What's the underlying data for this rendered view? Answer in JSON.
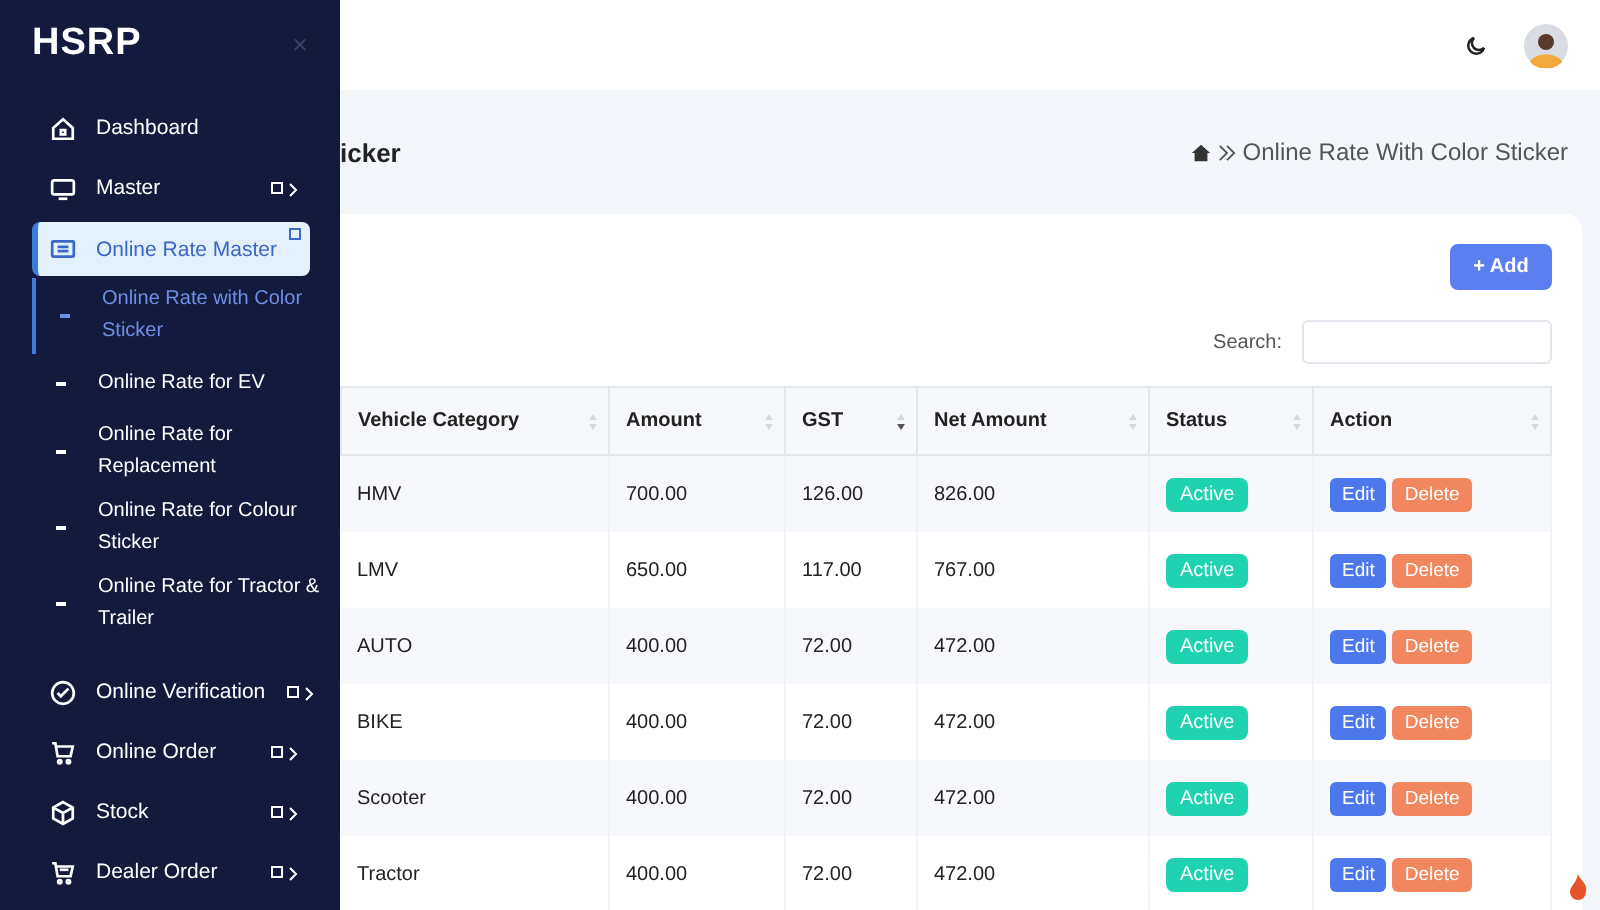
{
  "sidebar": {
    "brand": "HSRP",
    "close": "×",
    "items": [
      {
        "label": "Dashboard",
        "selected": false,
        "has_submenu": false
      },
      {
        "label": "Master",
        "selected": false,
        "has_submenu": true
      },
      {
        "label": "Online Rate Master",
        "selected": true,
        "has_submenu": true,
        "expanded": true,
        "children": [
          {
            "label": "Online Rate with Color Sticker",
            "selected": true
          },
          {
            "label": "Online Rate for EV",
            "selected": false
          },
          {
            "label": "Online Rate for Replacement",
            "selected": false
          },
          {
            "label": "Online Rate for Colour Sticker",
            "selected": false
          },
          {
            "label": "Online Rate for Tractor & Trailer",
            "selected": false
          }
        ]
      },
      {
        "label": "Online Verification",
        "selected": false,
        "has_submenu": true
      },
      {
        "label": "Online Order",
        "selected": false,
        "has_submenu": true
      },
      {
        "label": "Stock",
        "selected": false,
        "has_submenu": true
      },
      {
        "label": "Dealer Order",
        "selected": false,
        "has_submenu": true
      }
    ]
  },
  "page": {
    "title": "icker",
    "breadcrumb": "Online Rate With Color Sticker"
  },
  "card": {
    "add_button": "+ Add",
    "search": {
      "label": "Search:"
    },
    "table": {
      "columns": [
        {
          "label": "Vehicle Category",
          "sorted": false
        },
        {
          "label": "Amount",
          "sorted": false
        },
        {
          "label": "GST",
          "sorted": true
        },
        {
          "label": "Net Amount",
          "sorted": false
        },
        {
          "label": "Status",
          "sorted": false
        },
        {
          "label": "Action",
          "sorted": false
        }
      ],
      "rows": [
        {
          "category": "HMV",
          "amount": "700.00",
          "gst": "126.00",
          "net": "826.00",
          "status": "Active",
          "edit": "Edit",
          "delete": "Delete"
        },
        {
          "category": "LMV",
          "amount": "650.00",
          "gst": "117.00",
          "net": "767.00",
          "status": "Active",
          "edit": "Edit",
          "delete": "Delete"
        },
        {
          "category": "AUTO",
          "amount": "400.00",
          "gst": "72.00",
          "net": "472.00",
          "status": "Active",
          "edit": "Edit",
          "delete": "Delete"
        },
        {
          "category": "BIKE",
          "amount": "400.00",
          "gst": "72.00",
          "net": "472.00",
          "status": "Active",
          "edit": "Edit",
          "delete": "Delete"
        },
        {
          "category": "Scooter",
          "amount": "400.00",
          "gst": "72.00",
          "net": "472.00",
          "status": "Active",
          "edit": "Edit",
          "delete": "Delete"
        },
        {
          "category": "Tractor",
          "amount": "400.00",
          "gst": "72.00",
          "net": "472.00",
          "status": "Active",
          "edit": "Edit",
          "delete": "Delete"
        }
      ]
    }
  }
}
